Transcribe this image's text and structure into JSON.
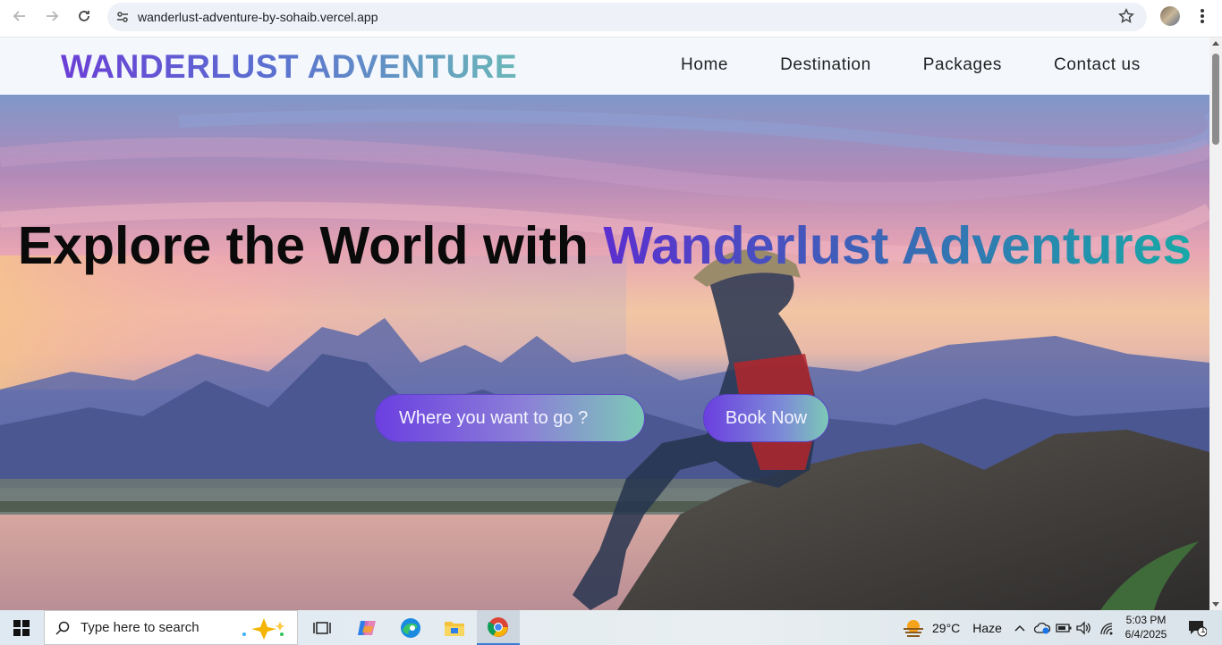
{
  "browser": {
    "url": "wanderlust-adventure-by-sohaib.vercel.app",
    "icons": [
      "back-arrow-icon",
      "forward-arrow-icon",
      "reload-icon",
      "site-settings-icon",
      "bookmark-star-icon",
      "profile-avatar",
      "menu-kebab-icon"
    ]
  },
  "site": {
    "logo": "WANDERLUST ADVENTURE",
    "nav": [
      "Home",
      "Destination",
      "Packages",
      "Contact us"
    ]
  },
  "hero": {
    "title_plain": "Explore the World with ",
    "title_brand": "Wanderlust Adventures",
    "search_placeholder": "Where you want to go ?",
    "book_label": "Book Now"
  },
  "taskbar": {
    "search_placeholder": "Type here to search",
    "weather_temp": "29°C",
    "weather_desc": "Haze",
    "time": "5:03 PM",
    "date": "6/4/2025",
    "notification_count": "1"
  },
  "colors": {
    "brand_purple": "#6b3fd6",
    "brand_teal": "#17a9a7",
    "header_bg": "#f4f8fd"
  }
}
